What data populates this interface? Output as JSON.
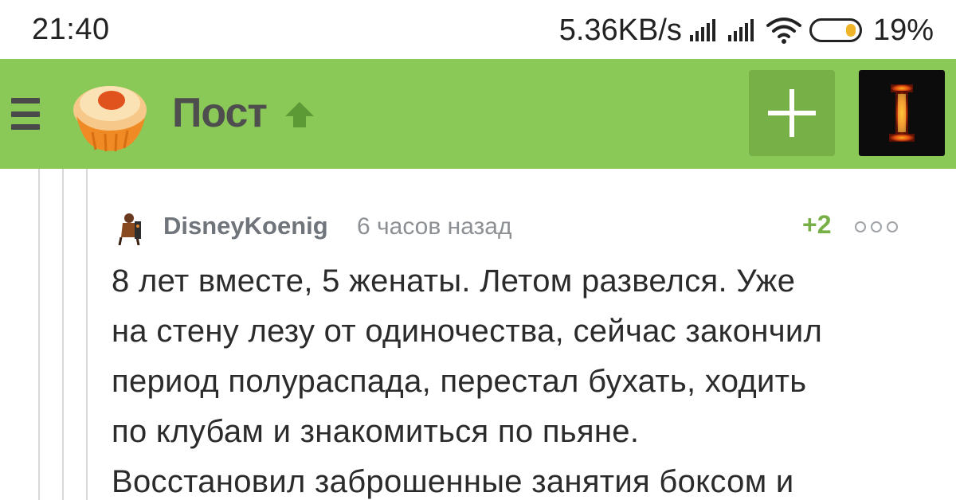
{
  "status_bar": {
    "time": "21:40",
    "network_speed": "5.36KB/s",
    "battery": "19%",
    "battery_level": 0.19,
    "icons": [
      "signal-icon",
      "signal-icon",
      "wifi-icon",
      "battery-icon"
    ]
  },
  "app_bar": {
    "title": "Пост",
    "icons": [
      "menu-icon",
      "cupcake-logo-icon",
      "arrow-up-icon",
      "plus-icon",
      "profile-avatar"
    ],
    "colors": {
      "bar": "#8ac858",
      "add_button": "#78b048",
      "title": "#4e4e4e"
    }
  },
  "comment": {
    "username": "DisneyKoenig",
    "time_ago": "6 часов назад",
    "rating": "+2",
    "lines": [
      "8 лет вместе, 5 женаты. Летом развелся. Уже",
      "на стену лезу от одиночества, сейчас закончил",
      "период полураспада, перестал бухать, ходить",
      "по клубам и знакомиться по пьяне.",
      "Восстановил заброшенные занятия боксом и"
    ],
    "colors": {
      "rating": "#78b048",
      "username": "#70747b",
      "text": "#2b2b2b"
    }
  }
}
